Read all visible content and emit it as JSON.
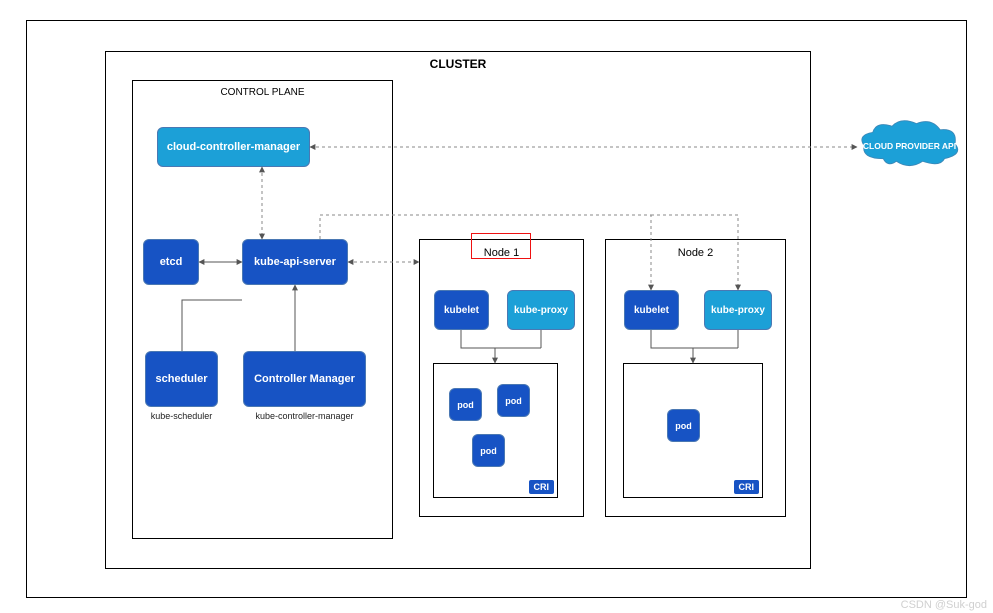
{
  "cluster_title": "CLUSTER",
  "control_plane_title": "CONTROL PLANE",
  "ccm": "cloud-controller-manager",
  "etcd": "etcd",
  "apiserver": "kube-api-server",
  "scheduler": "scheduler",
  "controller_manager": "Controller Manager",
  "caption_scheduler": "kube-scheduler",
  "caption_ctrlmgr": "kube-controller-manager",
  "node1_title": "Node 1",
  "node2_title": "Node 2",
  "kubelet": "kubelet",
  "kubeproxy": "kube-proxy",
  "cri": "CRI",
  "pod": "pod",
  "cloud_provider": "CLOUD PROVIDER API",
  "watermark": "CSDN @Suk-god",
  "colors": {
    "dark_blue": "#1753c4",
    "light_blue": "#1ca0d7",
    "highlight": "#e11"
  }
}
